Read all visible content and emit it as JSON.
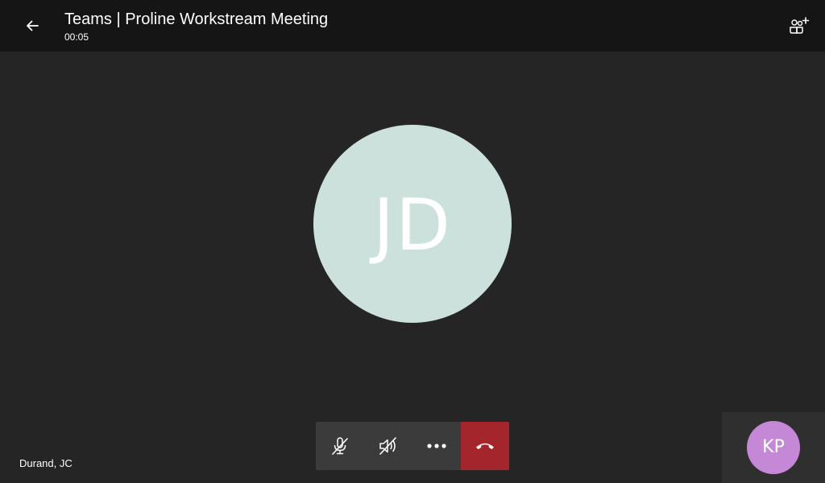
{
  "header": {
    "title": "Teams | Proline Workstream Meeting",
    "timer": "00:05",
    "back_icon": "arrow-left-icon",
    "add_people_icon": "add-people-icon"
  },
  "main_participant": {
    "initials": "JD",
    "avatar_color": "#cce1db"
  },
  "participant_name": "Durand, JC",
  "controls": {
    "mic": {
      "icon": "mic-off-icon",
      "state": "muted"
    },
    "speaker": {
      "icon": "speaker-off-icon",
      "state": "muted"
    },
    "more": {
      "icon": "more-horizontal-icon"
    },
    "hangup": {
      "icon": "hang-up-icon",
      "color": "#a4262c"
    }
  },
  "self_view": {
    "initials": "KP",
    "avatar_color": "#c588d6"
  },
  "colors": {
    "background": "#252525",
    "header": "#151515",
    "control": "#3b3b3b"
  }
}
